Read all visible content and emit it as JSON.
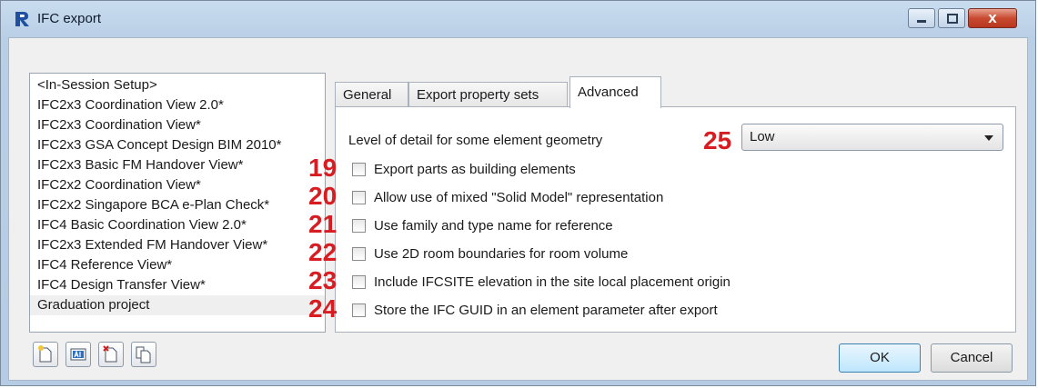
{
  "window": {
    "title": "IFC export",
    "close_label": "x"
  },
  "setups": [
    "<In-Session Setup>",
    "IFC2x3 Coordination View 2.0*",
    "IFC2x3 Coordination View*",
    "IFC2x3 GSA Concept Design BIM 2010*",
    "IFC2x3 Basic FM Handover View*",
    "IFC2x2 Coordination View*",
    "IFC2x2 Singapore BCA e-Plan Check*",
    "IFC4 Basic Coordination View 2.0*",
    "IFC2x3 Extended FM Handover View*",
    "IFC4 Reference View*",
    "IFC4 Design Transfer View*",
    "Graduation project"
  ],
  "tabs": [
    "General",
    "Export property sets",
    "Advanced"
  ],
  "advanced": {
    "lod_label": "Level of detail for some element geometry",
    "lod_value": "Low",
    "lod_annotation": "25",
    "options": [
      {
        "num": "19",
        "label": "Export parts as building elements"
      },
      {
        "num": "20",
        "label": "Allow use of mixed \"Solid Model\" representation"
      },
      {
        "num": "21",
        "label": "Use family and type name for reference"
      },
      {
        "num": "22",
        "label": "Use 2D room boundaries for room volume"
      },
      {
        "num": "23",
        "label": "Include IFCSITE elevation in the site local placement origin"
      },
      {
        "num": "24",
        "label": "Store the IFC GUID in an element parameter after export"
      }
    ]
  },
  "buttons": {
    "ok": "OK",
    "cancel": "Cancel"
  },
  "colors": {
    "annotation": "#d71d21",
    "titlebar": "#c9dcef",
    "close_button": "#c84a31"
  },
  "icons": [
    "revit-app-icon",
    "minimize-icon",
    "maximize-icon",
    "close-icon",
    "new-setup-icon",
    "rename-setup-icon",
    "delete-setup-icon",
    "duplicate-setup-icon",
    "dropdown-arrow-icon"
  ]
}
